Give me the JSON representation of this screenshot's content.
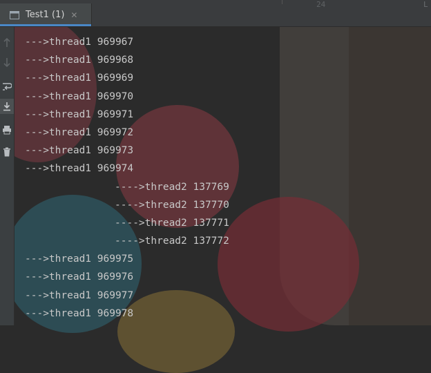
{
  "tab": {
    "title": "Test1 (1)",
    "close_icon": "close-icon",
    "run_icon": "console-window-icon"
  },
  "editor_hint": {
    "line_number": "24",
    "right_edge": "L"
  },
  "toolbar": [
    {
      "name": "up-arrow-icon",
      "label": "↑"
    },
    {
      "name": "down-arrow-icon",
      "label": "↓"
    },
    {
      "name": "soft-wrap-icon",
      "label": "↩"
    },
    {
      "name": "scroll-to-end-icon",
      "label": "⤓"
    },
    {
      "name": "print-icon",
      "label": "print"
    },
    {
      "name": "trash-icon",
      "label": "clear"
    }
  ],
  "console": {
    "lines": [
      {
        "text": "--->thread1 969967",
        "indent": false
      },
      {
        "text": "--->thread1 969968",
        "indent": false
      },
      {
        "text": "--->thread1 969969",
        "indent": false
      },
      {
        "text": "--->thread1 969970",
        "indent": false
      },
      {
        "text": "--->thread1 969971",
        "indent": false
      },
      {
        "text": "--->thread1 969972",
        "indent": false
      },
      {
        "text": "--->thread1 969973",
        "indent": false
      },
      {
        "text": "--->thread1 969974",
        "indent": false
      },
      {
        "text": "---->thread2 137769",
        "indent": true
      },
      {
        "text": "---->thread2 137770",
        "indent": true
      },
      {
        "text": "---->thread2 137771",
        "indent": true
      },
      {
        "text": "---->thread2 137772",
        "indent": true
      },
      {
        "text": "--->thread1 969975",
        "indent": false
      },
      {
        "text": "--->thread1 969976",
        "indent": false
      },
      {
        "text": "--->thread1 969977",
        "indent": false
      },
      {
        "text": "--->thread1 969978",
        "indent": false
      }
    ]
  },
  "colors": {
    "background": "#2b2b2b",
    "text": "#c8c8c8",
    "tab_accent": "#4a88c7",
    "wallpaper_red": "#8a3b44",
    "wallpaper_teal": "#2f5b66"
  }
}
